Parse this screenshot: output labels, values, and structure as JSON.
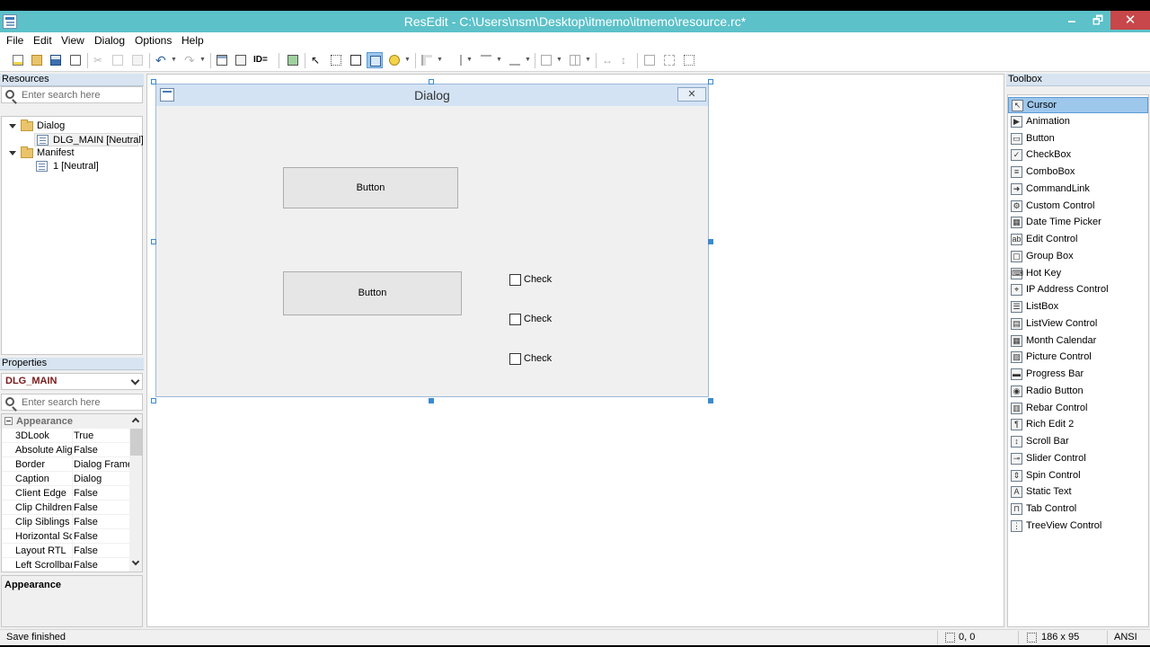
{
  "window": {
    "title": "ResEdit - C:\\Users\\nsm\\Desktop\\itmemo\\itmemo\\resource.rc*",
    "min": "🗕",
    "max": "🗗",
    "close": "✕"
  },
  "menu": [
    "File",
    "Edit",
    "View",
    "Dialog",
    "Options",
    "Help"
  ],
  "toolbar": {
    "icons": [
      "new-file-icon",
      "open-folder-icon",
      "save-icon",
      "print-preview-icon",
      "cut-icon",
      "copy-icon",
      "paste-icon",
      "undo-icon",
      "redo-icon",
      "dialog-view-icon",
      "code-view-icon",
      "id-icon",
      "test-dialog-icon",
      "select-cursor-icon",
      "grid-icon",
      "snap-icon",
      "guides-icon",
      "emoji-icon",
      "align-left-icon",
      "align-right-icon",
      "align-top-icon",
      "align-bottom-icon",
      "center-icon",
      "space-icon",
      "width-icon",
      "height-icon",
      "resize-icon",
      "size-icon"
    ],
    "id_label": "ID="
  },
  "resources": {
    "header": "Resources",
    "search_placeholder": "Enter search here",
    "tree": [
      {
        "label": "Dialog",
        "type": "folder",
        "level": 0
      },
      {
        "label": "DLG_MAIN [Neutral]",
        "type": "dialog",
        "level": 1
      },
      {
        "label": "Manifest",
        "type": "folder",
        "level": 0
      },
      {
        "label": "1 [Neutral]",
        "type": "manifest",
        "level": 1
      }
    ]
  },
  "properties": {
    "header": "Properties",
    "selected": "DLG_MAIN",
    "search_placeholder": "Enter search here",
    "category": "Appearance",
    "rows": [
      {
        "name": "3DLook",
        "value": "True"
      },
      {
        "name": "Absolute Align",
        "value": "False"
      },
      {
        "name": "Border",
        "value": "Dialog Frame"
      },
      {
        "name": "Caption",
        "value": "Dialog"
      },
      {
        "name": "Client Edge",
        "value": "False"
      },
      {
        "name": "Clip Children",
        "value": "False"
      },
      {
        "name": "Clip Siblings",
        "value": "False"
      },
      {
        "name": "Horizontal Scroll",
        "value": "False"
      },
      {
        "name": "Layout RTL",
        "value": "False"
      },
      {
        "name": "Left Scrollbar",
        "value": "False"
      }
    ],
    "description_title": "Appearance"
  },
  "dialog": {
    "title": "Dialog",
    "close": "✕",
    "buttons": [
      "Button",
      "Button"
    ],
    "checks": [
      "Check",
      "Check",
      "Check"
    ]
  },
  "toolbox": {
    "header": "Toolbox",
    "items": [
      {
        "label": "Cursor",
        "icon": "↖"
      },
      {
        "label": "Animation",
        "icon": "▶"
      },
      {
        "label": "Button",
        "icon": "▭"
      },
      {
        "label": "CheckBox",
        "icon": "✓"
      },
      {
        "label": "ComboBox",
        "icon": "≡"
      },
      {
        "label": "CommandLink",
        "icon": "➜"
      },
      {
        "label": "Custom Control",
        "icon": "⚙"
      },
      {
        "label": "Date Time Picker",
        "icon": "▦"
      },
      {
        "label": "Edit Control",
        "icon": "ab"
      },
      {
        "label": "Group Box",
        "icon": "▢"
      },
      {
        "label": "Hot Key",
        "icon": "⌨"
      },
      {
        "label": "IP Address Control",
        "icon": "⌖"
      },
      {
        "label": "ListBox",
        "icon": "☰"
      },
      {
        "label": "ListView Control",
        "icon": "▤"
      },
      {
        "label": "Month Calendar",
        "icon": "▦"
      },
      {
        "label": "Picture Control",
        "icon": "▨"
      },
      {
        "label": "Progress Bar",
        "icon": "▬"
      },
      {
        "label": "Radio Button",
        "icon": "◉"
      },
      {
        "label": "Rebar Control",
        "icon": "▥"
      },
      {
        "label": "Rich Edit 2",
        "icon": "¶"
      },
      {
        "label": "Scroll Bar",
        "icon": "↕"
      },
      {
        "label": "Slider Control",
        "icon": "⊸"
      },
      {
        "label": "Spin Control",
        "icon": "⇕"
      },
      {
        "label": "Static Text",
        "icon": "A"
      },
      {
        "label": "Tab Control",
        "icon": "⊓"
      },
      {
        "label": "TreeView Control",
        "icon": "⋮"
      }
    ]
  },
  "status": {
    "message": "Save finished",
    "position": "0, 0",
    "size": "186 x 95",
    "encoding": "ANSI"
  }
}
